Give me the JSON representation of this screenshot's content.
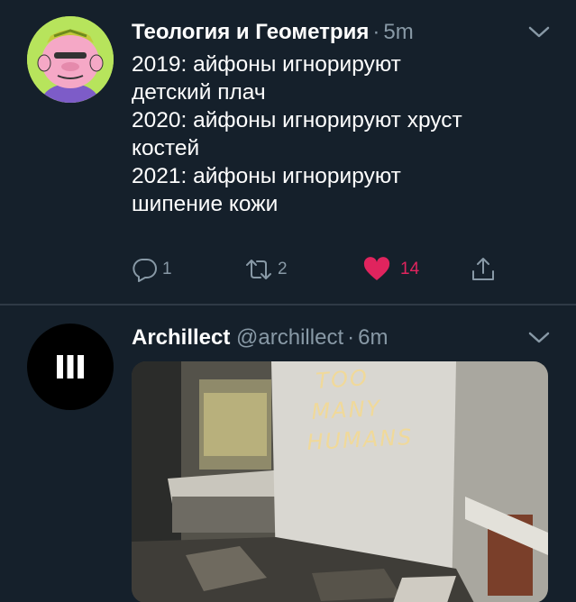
{
  "tweets": [
    {
      "author_name": "Теология и Геометрия",
      "separator": "·",
      "time": "5m",
      "text_lines": [
        "2019: айфоны игнорируют",
        "детский плач",
        "2020: айфоны игнорируют хруст",
        "костей",
        "2021: айфоны игнорируют",
        "шипение кожи"
      ],
      "actions": {
        "reply_count": "1",
        "retweet_count": "2",
        "like_count": "14",
        "liked": true
      },
      "avatar_icon": "cartoon-face-avatar",
      "caret_icon": "chevron-down-icon"
    },
    {
      "author_name": "Archillect",
      "handle": "@archillect",
      "separator": "·",
      "time": "6m",
      "avatar_icon": "three-bars-logo",
      "caret_icon": "chevron-down-icon",
      "media": {
        "graffiti_lines": [
          "TOO",
          "MANY",
          "HUMANS"
        ]
      }
    }
  ],
  "colors": {
    "background": "#15202b",
    "muted": "#8899a6",
    "like": "#e0245e",
    "divider": "#2f3a46"
  }
}
